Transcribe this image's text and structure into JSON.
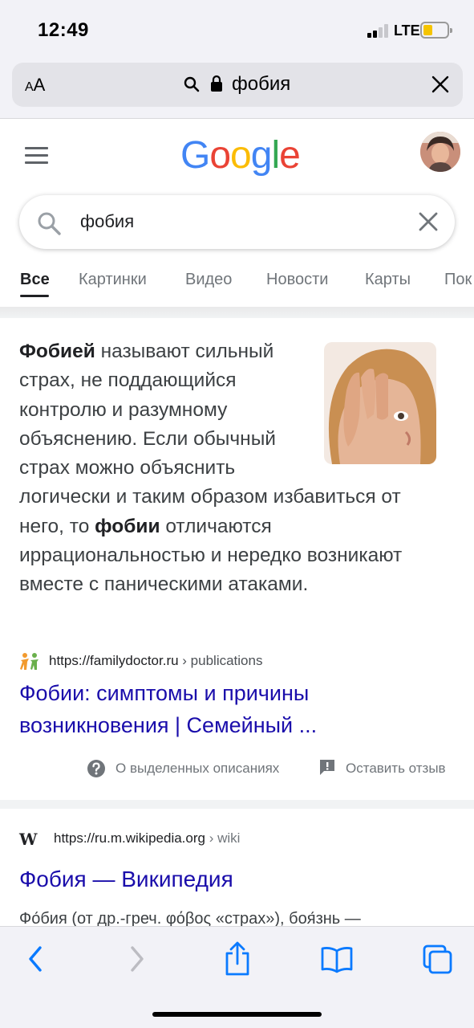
{
  "status_bar": {
    "time": "12:49",
    "network": "LTE",
    "signal_bars_active": 2,
    "signal_bars_total": 4,
    "battery_level": 0.4,
    "battery_color": "#f5c400"
  },
  "safari": {
    "text_size_label": "AA",
    "address_text": "фобия",
    "icons": [
      "search-icon",
      "lock-icon",
      "close-icon"
    ]
  },
  "google": {
    "logo_text": "Google",
    "logo_colors": [
      "#4285f4",
      "#ea4335",
      "#fbbc05",
      "#4285f4",
      "#34a853",
      "#ea4335"
    ],
    "search_query": "фобия",
    "tabs": [
      {
        "label": "Все",
        "active": true
      },
      {
        "label": "Картинки",
        "active": false
      },
      {
        "label": "Видео",
        "active": false
      },
      {
        "label": "Новости",
        "active": false
      },
      {
        "label": "Карты",
        "active": false
      },
      {
        "label": "Пок",
        "active": false
      }
    ]
  },
  "featured_snippet": {
    "bold_1": "Фобией",
    "text_1": " называют сильный страх, не поддающийся контролю и разумному объяснению. Если обычный страх можно объяснить логически и таким образом избавиться от него, то ",
    "bold_2": "фобии",
    "text_2": " отличаются иррациональностью и нередко возникают вместе с паническими атаками.",
    "source_url": "https://familydoctor.ru",
    "source_crumb": " › publications",
    "title_line1": "Фобии: симптомы и причины",
    "title_line2": "возникновения | Семейный ...",
    "about_label": "О выделенных описаниях",
    "feedback_label": "Оставить отзыв"
  },
  "wiki_result": {
    "favicon": "W",
    "url": "https://ru.m.wikipedia.org",
    "crumb": " › wiki",
    "title": "Фобия — Википедия",
    "snippet": "Фо́бия (от др.-греч. φόβος «страх»), боя́знь —"
  },
  "colors": {
    "link": "#1a0dab",
    "text": "#202124",
    "secondary": "#70757a",
    "ios_blue": "#0a7aff"
  }
}
